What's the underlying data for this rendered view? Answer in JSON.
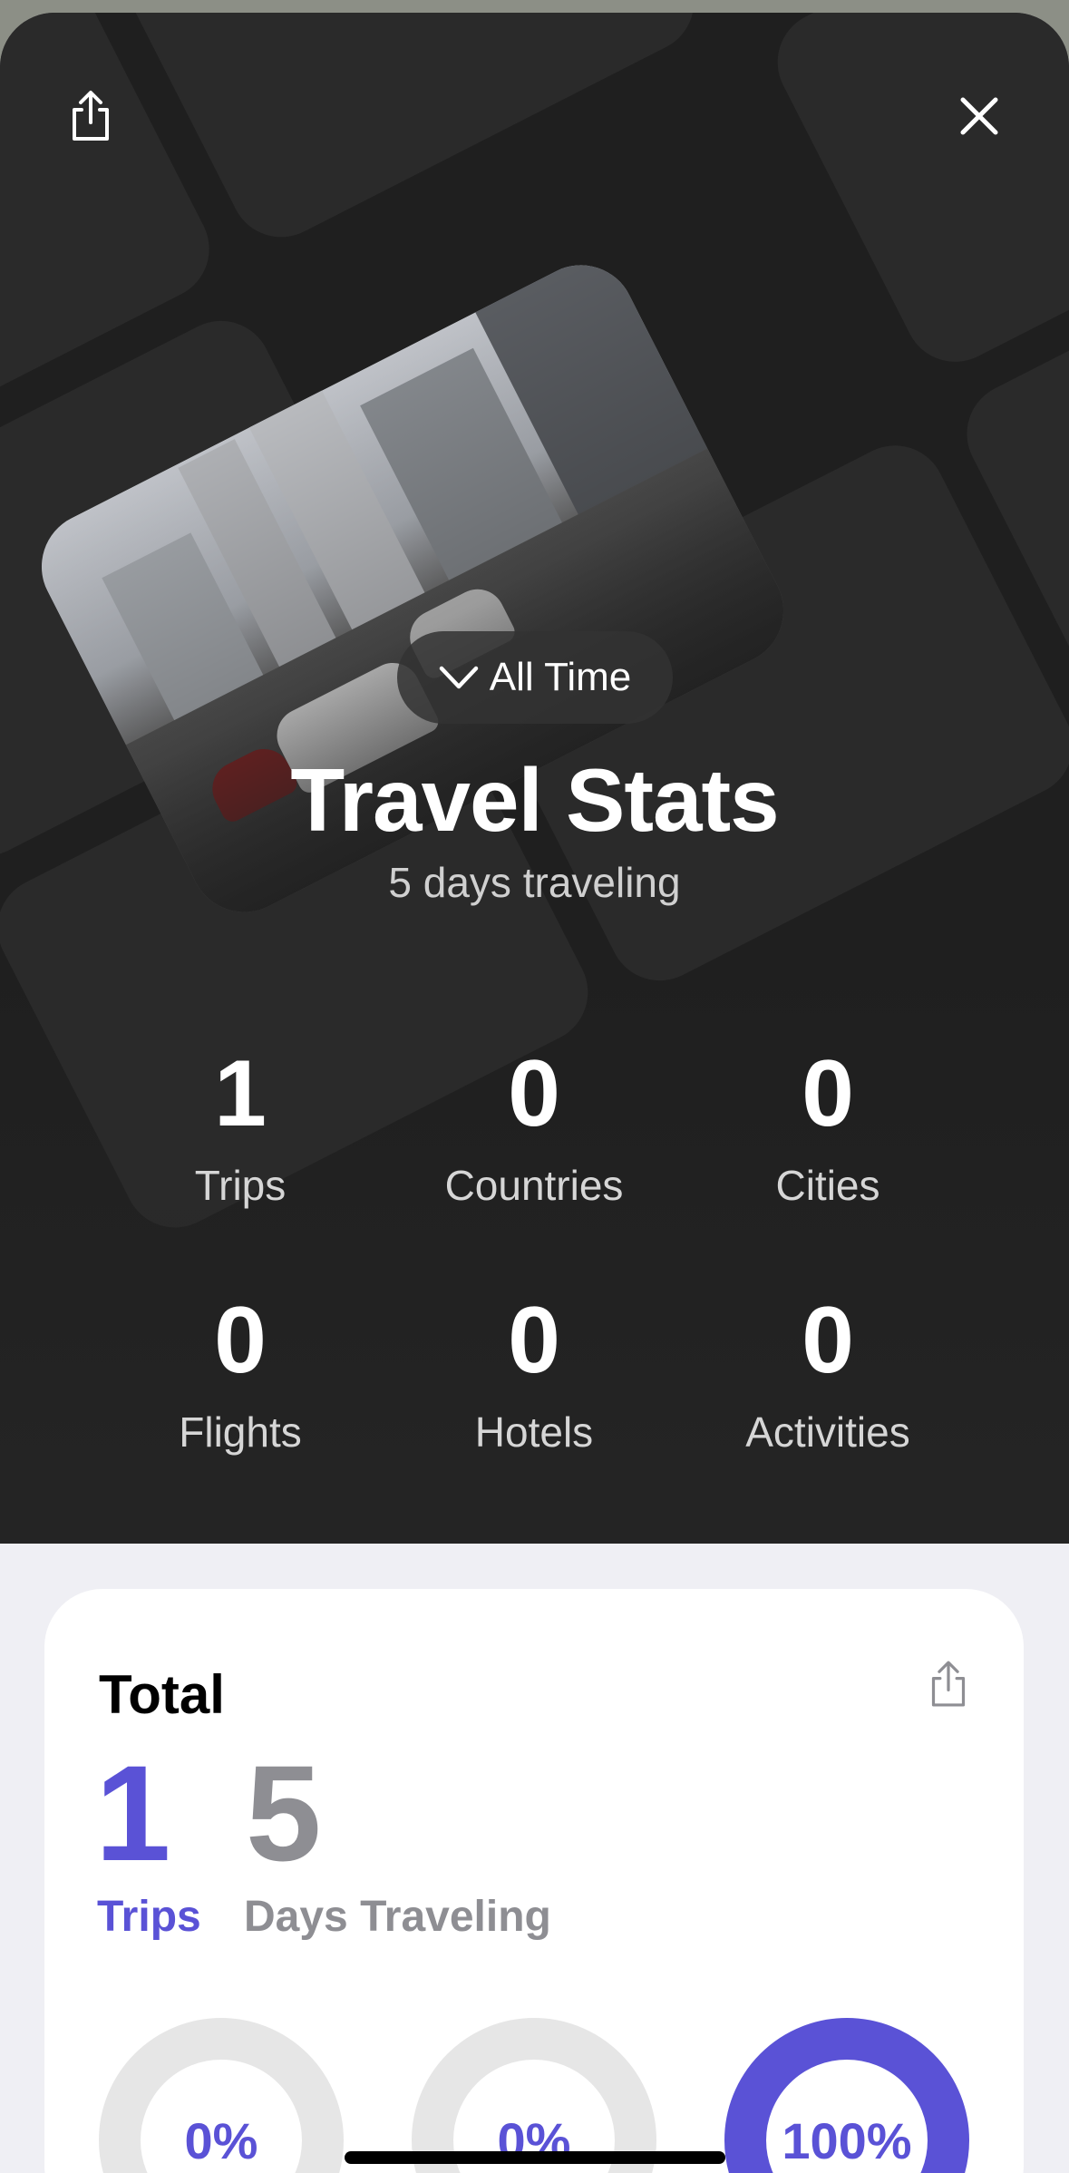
{
  "header": {
    "period_label": "All Time",
    "title": "Travel Stats",
    "subtitle": "5 days traveling"
  },
  "stats": [
    {
      "value": "1",
      "label": "Trips"
    },
    {
      "value": "0",
      "label": "Countries"
    },
    {
      "value": "0",
      "label": "Cities"
    },
    {
      "value": "0",
      "label": "Flights"
    },
    {
      "value": "0",
      "label": "Hotels"
    },
    {
      "value": "0",
      "label": "Activities"
    }
  ],
  "total_card": {
    "title": "Total",
    "trips_value": "1",
    "trips_label": "Trips",
    "days_value": "5",
    "days_label": "Days Traveling",
    "rings": [
      {
        "label": "0%",
        "percent": 0
      },
      {
        "label": "0%",
        "percent": 0
      },
      {
        "label": "100%",
        "percent": 100
      }
    ]
  },
  "icons": {
    "share": "share-icon",
    "close": "close-icon",
    "chevron": "chevron-down-icon"
  },
  "colors": {
    "accent": "#5a52d6",
    "hero_bg": "#1f1f1f",
    "muted_number": "#8e8e93"
  }
}
